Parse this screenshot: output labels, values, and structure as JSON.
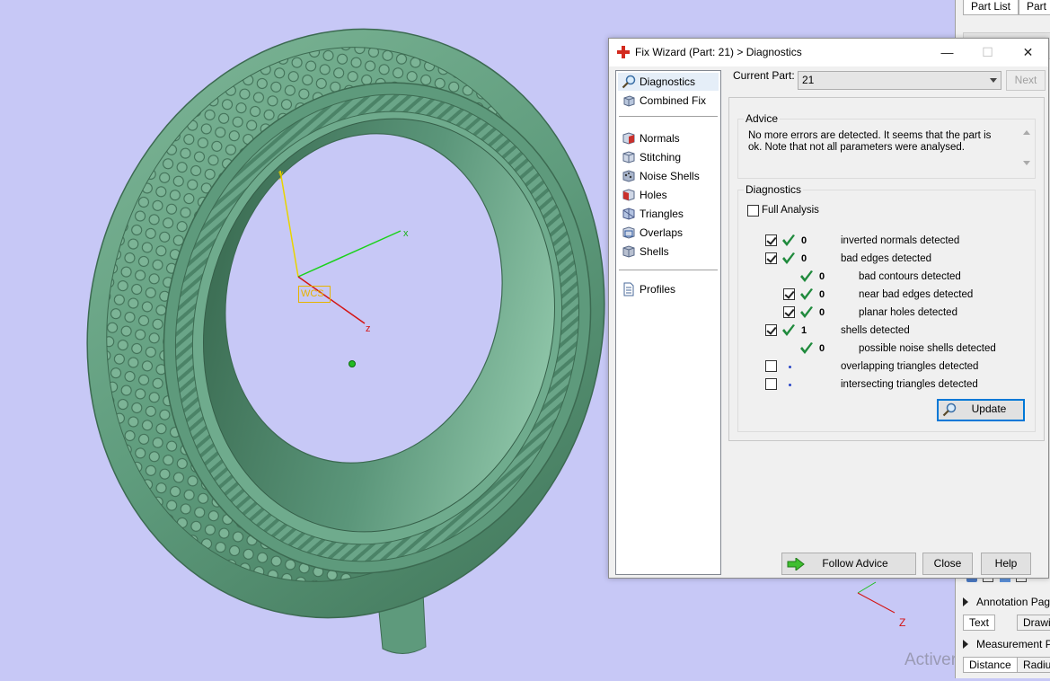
{
  "viewport": {
    "axes": {
      "x_label": "x",
      "y_label": "y",
      "z_label": "z",
      "wcs_label": "WCS"
    },
    "gizmo_z_label": "Z",
    "watermark": "Activer Windows",
    "model_color": "#5e9a7c",
    "background_color": "#c7c8f6"
  },
  "right_strip": {
    "tabs": [
      "Part List",
      "Part P"
    ],
    "rows": [
      {
        "label": "Annotation Pag"
      },
      {
        "label": "Measurement P"
      }
    ],
    "subtabs_1": [
      "Text",
      "Drawin"
    ],
    "subtabs_2": [
      "Distance",
      "Radiu"
    ]
  },
  "dialog": {
    "title": "Fix Wizard (Part: 21) > Diagnostics",
    "window_buttons": {
      "minimize": "—",
      "maximize": "☐",
      "close": "✕"
    },
    "nav": {
      "top": [
        {
          "label": "Diagnostics",
          "icon": "magnifier-icon",
          "selected": true
        },
        {
          "label": "Combined Fix",
          "icon": "cube-stack-icon",
          "selected": false
        }
      ],
      "fixes": [
        {
          "label": "Normals",
          "icon": "normals-cube-icon"
        },
        {
          "label": "Stitching",
          "icon": "stitching-cube-icon"
        },
        {
          "label": "Noise Shells",
          "icon": "noise-shells-icon"
        },
        {
          "label": "Holes",
          "icon": "holes-cube-icon"
        },
        {
          "label": "Triangles",
          "icon": "triangles-cube-icon"
        },
        {
          "label": "Overlaps",
          "icon": "overlaps-cube-icon"
        },
        {
          "label": "Shells",
          "icon": "shells-cube-icon"
        }
      ],
      "profiles": {
        "label": "Profiles",
        "icon": "document-icon"
      }
    },
    "current_part_label": "Current Part:",
    "current_part_value": "21",
    "next_button": "Next",
    "advice": {
      "legend": "Advice",
      "text": "No more errors are detected. It seems that the part is ok. Note that not all parameters were analysed."
    },
    "diagnostics": {
      "legend": "Diagnostics",
      "full_analysis_label": "Full Analysis",
      "full_analysis_checked": false,
      "rows": [
        {
          "checkbox": true,
          "checked": true,
          "status": "ok",
          "count": "0",
          "label": "inverted normals detected",
          "indent": 0
        },
        {
          "checkbox": true,
          "checked": true,
          "status": "ok",
          "count": "0",
          "label": "bad edges detected",
          "indent": 0
        },
        {
          "checkbox": false,
          "checked": false,
          "status": "ok",
          "count": "0",
          "label": "bad contours detected",
          "indent": 1
        },
        {
          "checkbox": true,
          "checked": true,
          "status": "ok",
          "count": "0",
          "label": "near bad edges detected",
          "indent": 1
        },
        {
          "checkbox": true,
          "checked": true,
          "status": "ok",
          "count": "0",
          "label": "planar holes detected",
          "indent": 1
        },
        {
          "checkbox": true,
          "checked": true,
          "status": "ok",
          "count": "1",
          "label": "shells detected",
          "indent": 0
        },
        {
          "checkbox": false,
          "checked": false,
          "status": "ok",
          "count": "0",
          "label": "possible noise shells detected",
          "indent": 1
        },
        {
          "checkbox": true,
          "checked": false,
          "status": "pending",
          "count": "",
          "label": "overlapping triangles detected",
          "indent": 0
        },
        {
          "checkbox": true,
          "checked": false,
          "status": "pending",
          "count": "",
          "label": "intersecting triangles detected",
          "indent": 0
        }
      ],
      "update_button": "Update"
    },
    "footer": {
      "follow_advice": "Follow Advice",
      "close": "Close",
      "help": "Help"
    },
    "colors": {
      "check_green": "#1f8a3c",
      "accent_blue": "#0078d7",
      "title_icon_red": "#d32a1e"
    }
  }
}
